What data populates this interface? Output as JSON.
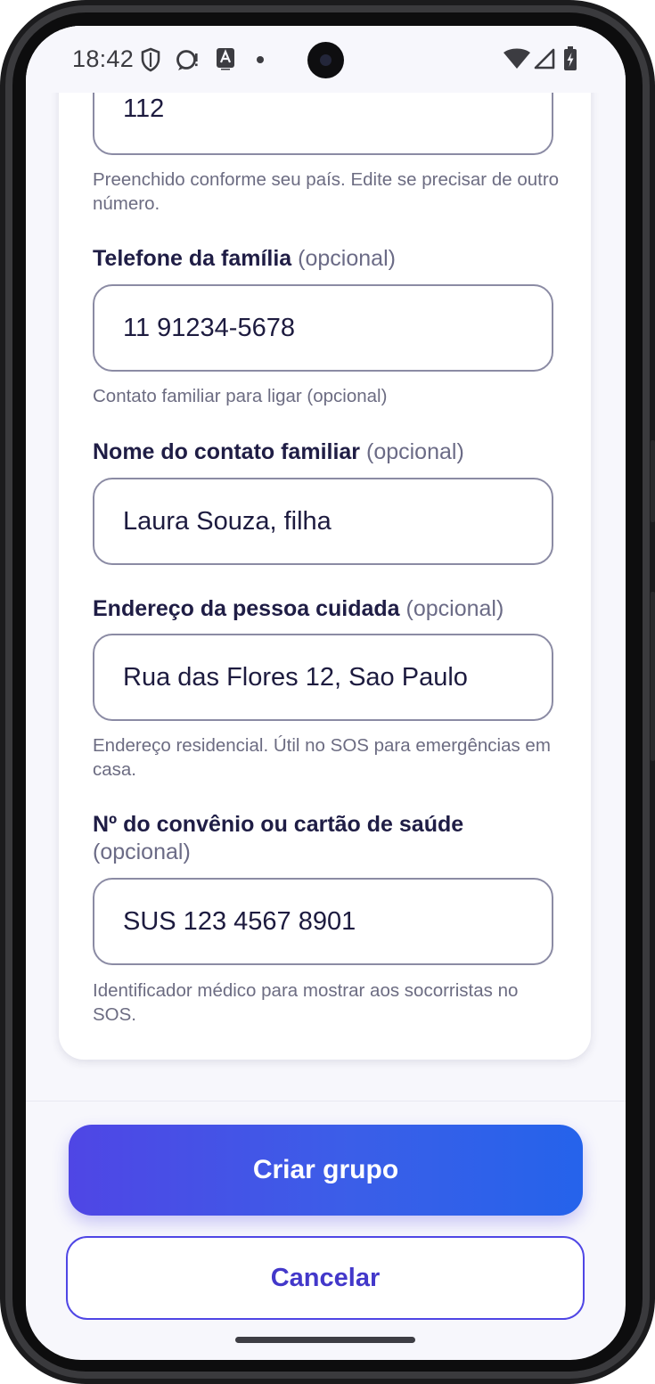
{
  "status_bar": {
    "time": "18:42",
    "icons_left": [
      "shield-icon",
      "chat-alert-icon",
      "text-a-icon",
      "dot-icon"
    ],
    "icons_right": [
      "wifi-icon",
      "signal-icon",
      "battery-charging-icon"
    ]
  },
  "form": {
    "emergency_number": {
      "value": "112",
      "helper": "Preenchido conforme seu país. Edite se precisar de outro número."
    },
    "family_phone": {
      "label": "Telefone da família",
      "optional": "(opcional)",
      "value": "11 91234-5678",
      "helper": "Contato familiar para ligar (opcional)"
    },
    "family_contact_name": {
      "label": "Nome do contato familiar",
      "optional": "(opcional)",
      "value": "Laura Souza, filha"
    },
    "address": {
      "label": "Endereço da pessoa cuidada",
      "optional": "(opcional)",
      "value": "Rua das Flores 12, Sao Paulo",
      "helper": "Endereço residencial. Útil no SOS para emergências em casa."
    },
    "health_card": {
      "label": "Nº do convênio ou cartão de saúde",
      "optional": "(opcional)",
      "value": "SUS 123 4567 8901",
      "helper": "Identificador médico para mostrar aos socorristas no SOS."
    }
  },
  "actions": {
    "create_label": "Criar grupo",
    "cancel_label": "Cancelar"
  },
  "colors": {
    "primary_start": "#4f46e5",
    "primary_end": "#2563eb",
    "label_text": "#1f1d45",
    "helper_text": "#6c6c82",
    "field_border": "#8b8ba4",
    "background": "#f7f7fc"
  }
}
